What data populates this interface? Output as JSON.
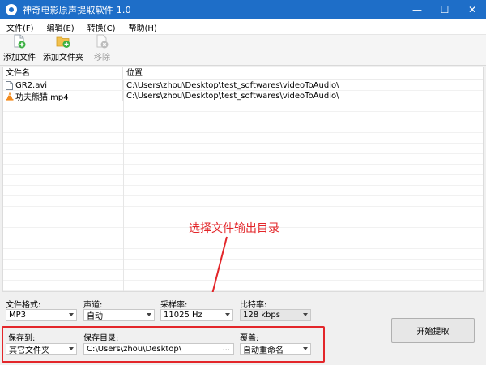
{
  "window": {
    "title": "神奇电影原声提取软件 1.0",
    "controls": {
      "minimize": "—",
      "maximize": "☐",
      "close": "✕"
    }
  },
  "menu": [
    {
      "label": "文件(F)"
    },
    {
      "label": "编辑(E)"
    },
    {
      "label": "转换(C)"
    },
    {
      "label": "帮助(H)"
    }
  ],
  "toolbar": {
    "add_file": "添加文件",
    "add_folder": "添加文件夹",
    "remove": "移除"
  },
  "file_list": {
    "columns": {
      "name": "文件名",
      "path": "位置"
    },
    "rows": [
      {
        "name": "GR2.avi",
        "path": "C:\\Users\\zhou\\Desktop\\test_softwares\\videoToAudio\\",
        "icon": "document-icon"
      },
      {
        "name": "功夫熊猫.mp4",
        "path": "C:\\Users\\zhou\\Desktop\\test_softwares\\videoToAudio\\",
        "icon": "vlc-cone-icon"
      }
    ]
  },
  "annotation": {
    "text": "选择文件输出目录",
    "color": "#e3262a"
  },
  "settings": {
    "format_label": "文件格式:",
    "format_value": "MP3",
    "channel_label": "声道:",
    "channel_value": "自动",
    "samplerate_label": "采样率:",
    "samplerate_value": "11025 Hz",
    "bitrate_label": "比特率:",
    "bitrate_value": "128 kbps",
    "saveto_label": "保存到:",
    "saveto_value": "其它文件夹",
    "savedir_label": "保存目录:",
    "savedir_value": "C:\\Users\\zhou\\Desktop\\",
    "savedir_browse": "...",
    "overwrite_label": "覆盖:",
    "overwrite_value": "自动重命名"
  },
  "start_button": "开始提取",
  "colors": {
    "titlebar": "#1e6ec8",
    "highlight": "#e3262a"
  }
}
